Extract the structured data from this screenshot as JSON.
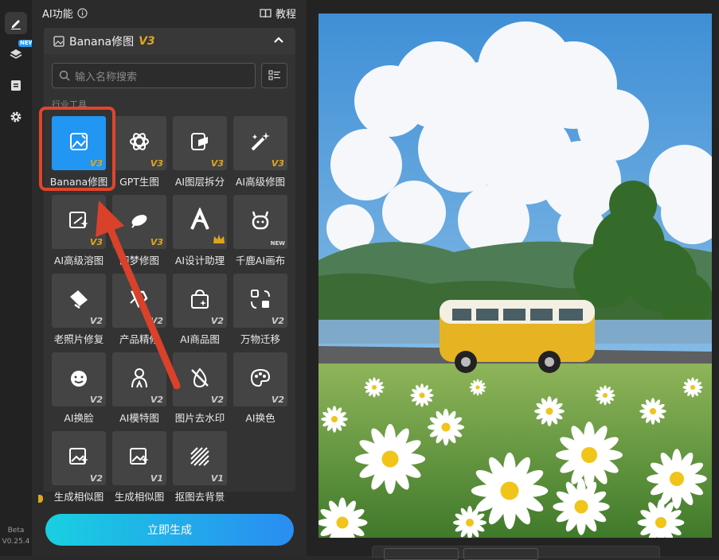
{
  "rail": {
    "new_badge": "NEW",
    "beta_label": "Beta",
    "version": "V0.25.4"
  },
  "panel": {
    "heading": "AI功能",
    "tutorial": "教程",
    "feature_title": "Banana修图",
    "feature_version": "V3",
    "search_placeholder": "输入名称搜索",
    "section_label": "行业工具"
  },
  "tools": [
    {
      "label": "Banana修图",
      "version": "V3",
      "icon": "image-edit-icon"
    },
    {
      "label": "GPT生图",
      "version": "V3",
      "icon": "gpt-logo-icon"
    },
    {
      "label": "AI图层拆分",
      "version": "V3",
      "icon": "layer-split-icon"
    },
    {
      "label": "AI高级修图",
      "version": "V3",
      "icon": "magic-wand-icon"
    },
    {
      "label": "AI高级溶图",
      "version": "V3",
      "icon": "image-sparkle-icon"
    },
    {
      "label": "即梦修图",
      "version": "V3",
      "icon": "dream-icon"
    },
    {
      "label": "AI设计助理",
      "version": "",
      "icon": "design-assistant-icon"
    },
    {
      "label": "千鹿AI画布",
      "version": "NEW",
      "icon": "deer-icon"
    },
    {
      "label": "老照片修复",
      "version": "V2",
      "icon": "photo-repair-icon"
    },
    {
      "label": "产品精修",
      "version": "V2",
      "icon": "product-retouch-icon"
    },
    {
      "label": "AI商品图",
      "version": "V2",
      "icon": "shopping-bag-icon"
    },
    {
      "label": "万物迁移",
      "version": "V2",
      "icon": "transfer-icon"
    },
    {
      "label": "AI换脸",
      "version": "V2",
      "icon": "face-swap-icon"
    },
    {
      "label": "AI模特图",
      "version": "V2",
      "icon": "model-icon"
    },
    {
      "label": "图片去水印",
      "version": "V2",
      "icon": "watermark-remove-icon"
    },
    {
      "label": "AI换色",
      "version": "V2",
      "icon": "palette-icon"
    },
    {
      "label": "生成相似图",
      "version": "V2",
      "icon": "similar-image-icon"
    },
    {
      "label": "生成相似图",
      "version": "V1",
      "icon": "similar-image-icon"
    },
    {
      "label": "抠图去背景",
      "version": "V1",
      "icon": "remove-bg-icon"
    }
  ],
  "generate_button": "立即生成",
  "colors": {
    "accent": "#2196f3",
    "gold": "#e0a51e",
    "highlight": "#e0452c",
    "button_gradient_start": "#19cfe0",
    "button_gradient_end": "#2a8df2"
  }
}
